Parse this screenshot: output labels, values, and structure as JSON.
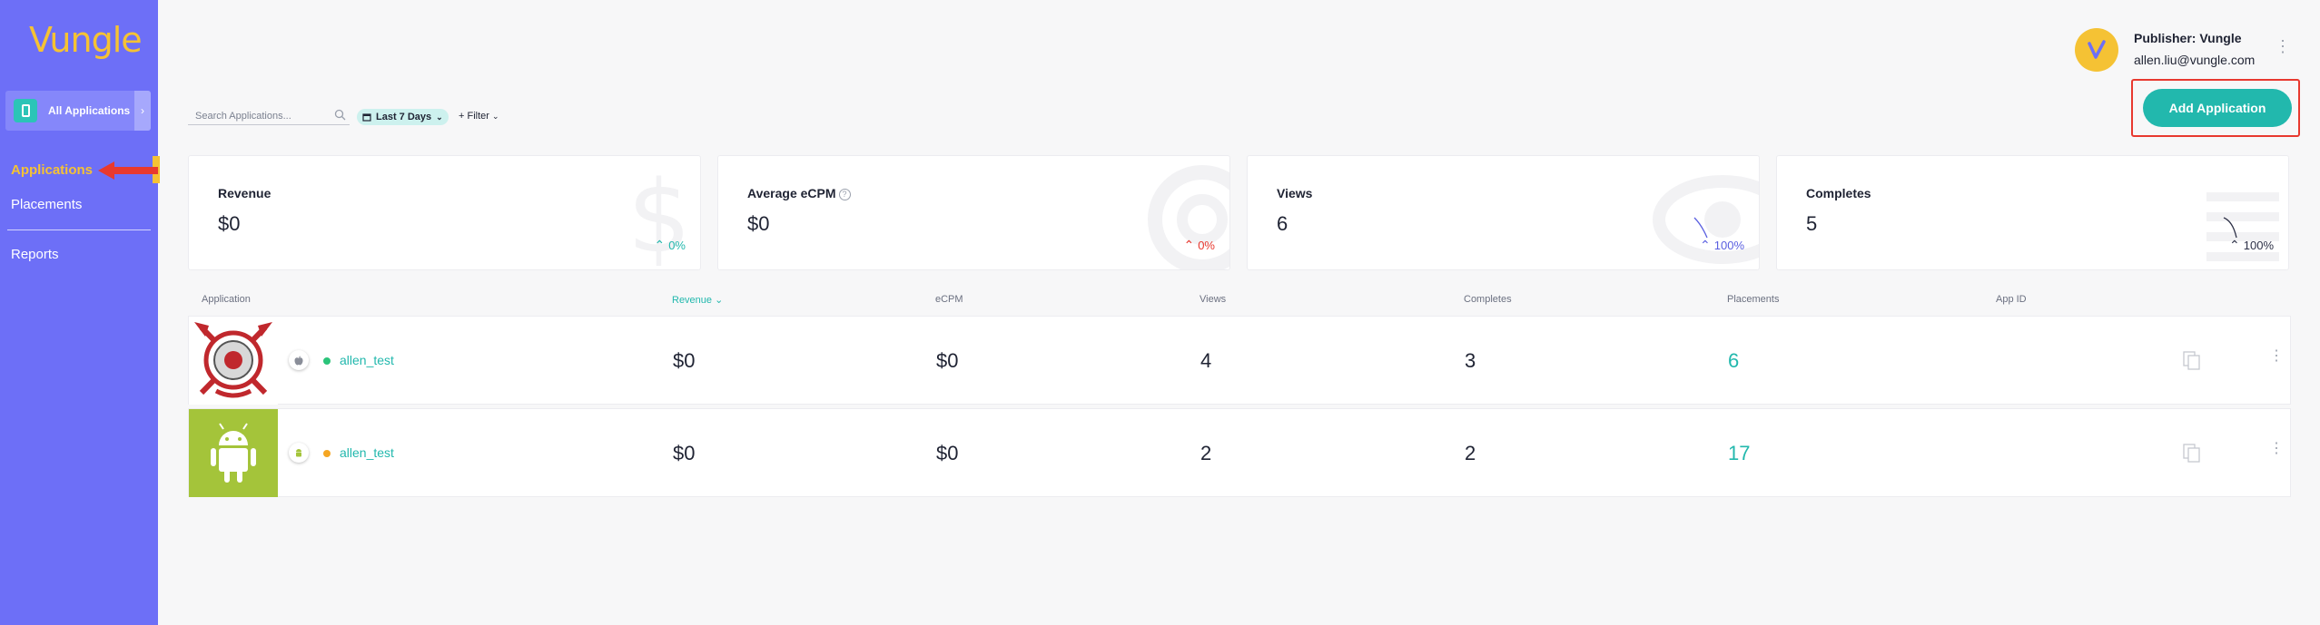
{
  "sidebar": {
    "logo": "Vungle",
    "app_switcher_label": "All Applications",
    "items": [
      {
        "label": "Applications",
        "active": true
      },
      {
        "label": "Placements",
        "active": false
      },
      {
        "label": "Reports",
        "active": false
      }
    ]
  },
  "account": {
    "publisher": "Publisher: Vungle",
    "email": "allen.liu@vungle.com"
  },
  "toolbar": {
    "search_placeholder": "Search Applications...",
    "date_range": "Last 7 Days",
    "filter_label": "+ Filter",
    "add_button": "Add Application"
  },
  "stats": [
    {
      "title": "Revenue",
      "value": "$0",
      "change": "0%",
      "direction": "up",
      "color": "#22b8ad",
      "icon": "dollar-icon"
    },
    {
      "title": "Average eCPM",
      "value": "$0",
      "change": "0%",
      "direction": "up",
      "color": "#e8392f",
      "icon": "gauge-icon"
    },
    {
      "title": "Views",
      "value": "6",
      "change": "100%",
      "direction": "up",
      "color": "#5a5fe0",
      "icon": "eye-icon"
    },
    {
      "title": "Completes",
      "value": "5",
      "change": "100%",
      "direction": "up",
      "color": "#2d3147",
      "icon": "list-icon"
    }
  ],
  "table": {
    "headers": [
      "Application",
      "Revenue",
      "eCPM",
      "Views",
      "Completes",
      "Placements",
      "App ID"
    ],
    "rows": [
      {
        "platform": "apple",
        "status_color": "#2bc47a",
        "name": "allen_test",
        "revenue": "$0",
        "ecpm": "$0",
        "views": "4",
        "completes": "3",
        "placements": "6"
      },
      {
        "platform": "android",
        "status_color": "#f5a623",
        "name": "allen_test",
        "revenue": "$0",
        "ecpm": "$0",
        "views": "2",
        "completes": "2",
        "placements": "17"
      }
    ]
  },
  "colors": {
    "sidebar": "#6d6ff7",
    "accent": "#22b8ad",
    "logo": "#f5c234",
    "highlight": "#e8392f"
  }
}
